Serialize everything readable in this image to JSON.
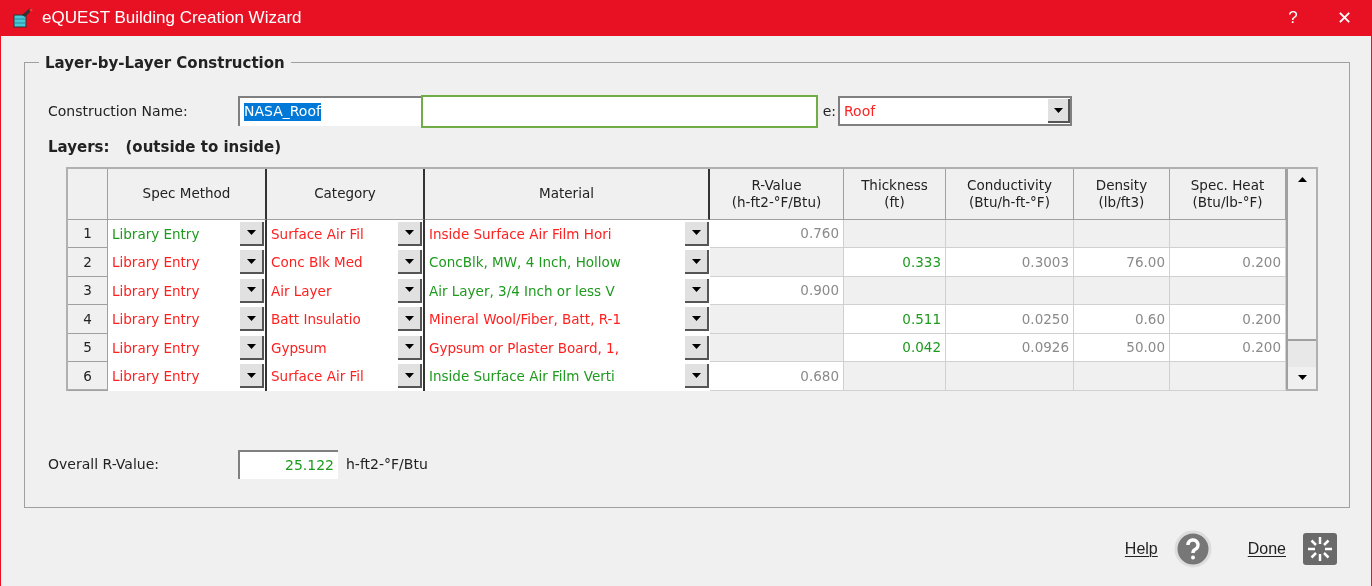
{
  "window": {
    "title": "eQUEST Building Creation Wizard",
    "help_glyph": "?",
    "close_glyph": "✕"
  },
  "group": {
    "title": "Layer-by-Layer Construction"
  },
  "construction_name": {
    "label": "Construction Name:",
    "value": "NASA_Roof"
  },
  "type_field": {
    "label": "e:",
    "value": "Roof",
    "color": "#ff2020"
  },
  "layers": {
    "label": "Layers:",
    "note": "(outside to inside)"
  },
  "table": {
    "columns": [
      "Spec Method",
      "Category",
      "Material",
      "R-Value\n(h-ft2-°F/Btu)",
      "Thickness\n(ft)",
      "Conductivity\n(Btu/h-ft-°F)",
      "Density\n(lb/ft3)",
      "Spec. Heat\n(Btu/lb-°F)"
    ],
    "rows": [
      {
        "number": "1",
        "spec_method": {
          "text": "Library Entry",
          "color": "#1e9a1e"
        },
        "category": {
          "text": "Surface Air Fil",
          "color": "#ff2020"
        },
        "material": {
          "text": "Inside Surface Air Film Hori",
          "color": "#ff2020"
        },
        "r_value": "0.760"
      },
      {
        "number": "2",
        "spec_method": {
          "text": "Library Entry",
          "color": "#ff2020"
        },
        "category": {
          "text": "Conc Blk Med",
          "color": "#ff2020"
        },
        "material": {
          "text": "ConcBlk, MW, 4 Inch, Hollow",
          "color": "#1e9a1e"
        },
        "thickness": "0.333",
        "conductivity": "0.3003",
        "density": "76.00",
        "spec_heat": "0.200"
      },
      {
        "number": "3",
        "spec_method": {
          "text": "Library Entry",
          "color": "#ff2020"
        },
        "category": {
          "text": "Air Layer",
          "color": "#ff2020"
        },
        "material": {
          "text": "Air Layer, 3/4 Inch or less V",
          "color": "#1e9a1e"
        },
        "r_value": "0.900"
      },
      {
        "number": "4",
        "spec_method": {
          "text": "Library Entry",
          "color": "#ff2020"
        },
        "category": {
          "text": "Batt Insulatio",
          "color": "#ff2020"
        },
        "material": {
          "text": "Mineral Wool/Fiber, Batt, R-1",
          "color": "#ff2020"
        },
        "thickness": "0.511",
        "conductivity": "0.0250",
        "density": "0.60",
        "spec_heat": "0.200"
      },
      {
        "number": "5",
        "spec_method": {
          "text": "Library Entry",
          "color": "#ff2020"
        },
        "category": {
          "text": "Gypsum",
          "color": "#ff2020"
        },
        "material": {
          "text": "Gypsum or Plaster Board, 1,",
          "color": "#ff2020"
        },
        "thickness": "0.042",
        "conductivity": "0.0926",
        "density": "50.00",
        "spec_heat": "0.200"
      },
      {
        "number": "6",
        "spec_method": {
          "text": "Library Entry",
          "color": "#ff2020"
        },
        "category": {
          "text": "Surface Air Fil",
          "color": "#ff2020"
        },
        "material": {
          "text": "Inside Surface Air Film Verti",
          "color": "#1e9a1e"
        },
        "r_value": "0.680"
      }
    ]
  },
  "overall": {
    "label": "Overall R-Value:",
    "value": "25.122",
    "unit": "h-ft2-°F/Btu"
  },
  "buttons": [
    {
      "kind": "help",
      "label": "Help"
    },
    {
      "kind": "done",
      "label": "Done"
    }
  ]
}
